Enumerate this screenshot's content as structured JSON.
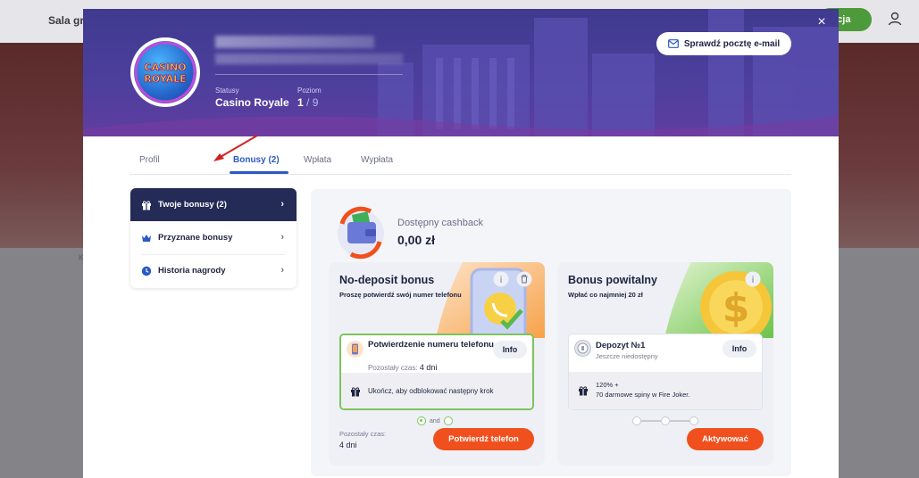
{
  "background": {
    "nav_item": "Sala gry",
    "login_fragment": "jacja",
    "side_letter": "K"
  },
  "header": {
    "status_label": "Statusy",
    "status_value": "Casino Royale",
    "level_label": "Poziom",
    "level_current": "1",
    "level_sep": " / ",
    "level_max": "9",
    "email_button": "Sprawdź pocztę e-mail",
    "close": "×",
    "logo_text_1": "CASINO",
    "logo_text_2": "ROYALE"
  },
  "tabs": [
    {
      "label": "Profil"
    },
    {
      "label": "Bonusy (2)",
      "active": true
    },
    {
      "label": "Wpłata"
    },
    {
      "label": "Wypłata"
    }
  ],
  "sidebar": {
    "items": [
      {
        "label": "Twoje bonusy (2)",
        "icon": "gift-icon",
        "active": true
      },
      {
        "label": "Przyznane bonusy",
        "icon": "crown-icon"
      },
      {
        "label": "Historia nagrody",
        "icon": "clock-icon"
      }
    ]
  },
  "cashback": {
    "title": "Dostępny cashback",
    "value": "0,00 zł"
  },
  "cards": [
    {
      "title": "No-deposit bonus",
      "subtitle": "Proszę potwierdź swój numer telefonu",
      "item_title": "Potwierdzenie numeru telefonu",
      "item_sub_label": "Pozostały czas:",
      "item_sub_value": "4 dni",
      "info": "Info",
      "bottom_text": "Ukończ, aby odblokować następny krok",
      "dots_and": "and",
      "time_label": "Pozostały czas:",
      "time_value": "4 dni",
      "cta": "Potwierdź telefon"
    },
    {
      "title": "Bonus powitalny",
      "subtitle": "Wpłać co najmniej 20 zł",
      "item_title": "Depozyt №1",
      "item_sub": "Jeszcze niedostępny",
      "info": "Info",
      "bottom_line1": "120% +",
      "bottom_line2": "70 darmowe spiny w Fire Joker.",
      "cta": "Aktywować"
    }
  ],
  "colors": {
    "accent_blue": "#2b59c3",
    "cta_orange": "#f0501e",
    "success_green": "#7cc45c",
    "sidebar_active": "#252b57"
  }
}
